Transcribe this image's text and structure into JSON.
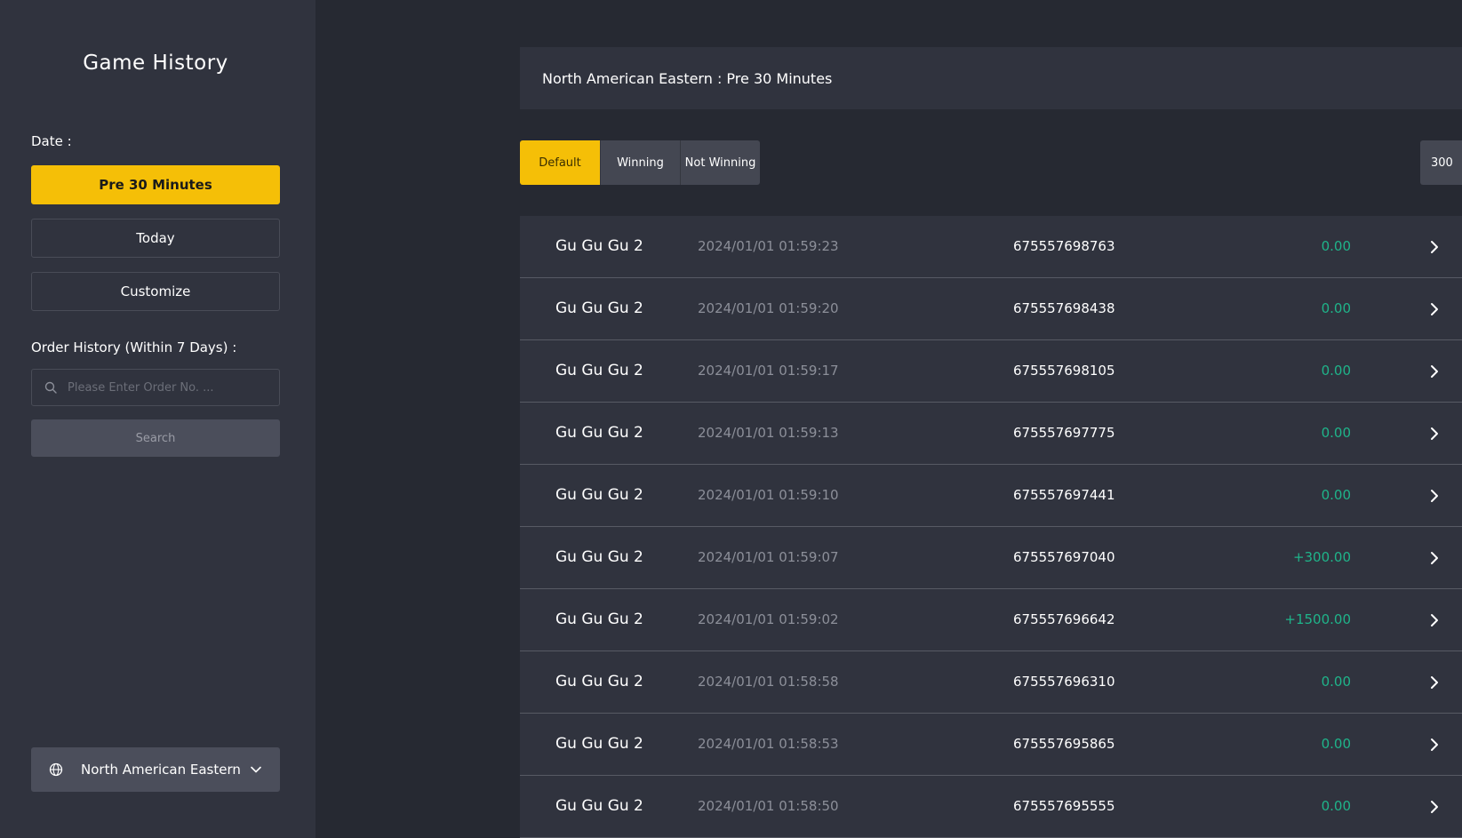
{
  "sidebar": {
    "title": "Game History",
    "date_label": "Date :",
    "date_options": [
      "Pre 30 Minutes",
      "Today",
      "Customize"
    ],
    "selected_date": "Pre 30 Minutes",
    "order_history_label": "Order History (Within 7 Days) :",
    "order_search": {
      "placeholder": "Please Enter Order No. ...",
      "value": ""
    },
    "search_button": "Search",
    "timezone": "North American Eastern"
  },
  "main": {
    "info": "North American Eastern : Pre 30 Minutes",
    "filters": [
      "Default",
      "Winning",
      "Not Winning"
    ],
    "active_filter": "Default",
    "page_size": "300",
    "rows": [
      {
        "game": "Gu Gu Gu 2",
        "time": "2024/01/01 01:59:23",
        "order": "675557698763",
        "amount": "0.00"
      },
      {
        "game": "Gu Gu Gu 2",
        "time": "2024/01/01 01:59:20",
        "order": "675557698438",
        "amount": "0.00"
      },
      {
        "game": "Gu Gu Gu 2",
        "time": "2024/01/01 01:59:17",
        "order": "675557698105",
        "amount": "0.00"
      },
      {
        "game": "Gu Gu Gu 2",
        "time": "2024/01/01 01:59:13",
        "order": "675557697775",
        "amount": "0.00"
      },
      {
        "game": "Gu Gu Gu 2",
        "time": "2024/01/01 01:59:10",
        "order": "675557697441",
        "amount": "0.00"
      },
      {
        "game": "Gu Gu Gu 2",
        "time": "2024/01/01 01:59:07",
        "order": "675557697040",
        "amount": "+300.00"
      },
      {
        "game": "Gu Gu Gu 2",
        "time": "2024/01/01 01:59:02",
        "order": "675557696642",
        "amount": "+1500.00"
      },
      {
        "game": "Gu Gu Gu 2",
        "time": "2024/01/01 01:58:58",
        "order": "675557696310",
        "amount": "0.00"
      },
      {
        "game": "Gu Gu Gu 2",
        "time": "2024/01/01 01:58:53",
        "order": "675557695865",
        "amount": "0.00"
      },
      {
        "game": "Gu Gu Gu 2",
        "time": "2024/01/01 01:58:50",
        "order": "675557695555",
        "amount": "0.00"
      }
    ]
  },
  "colors": {
    "accent": "#f5bf07",
    "win_amount": "#1fb48a",
    "sidebar_bg": "#30333e",
    "page_bg": "#262932"
  },
  "icons": {
    "search": "search-icon",
    "globe": "globe-icon",
    "dropdown": "chevron-down-icon",
    "row_arrow": "chevron-right-icon"
  }
}
